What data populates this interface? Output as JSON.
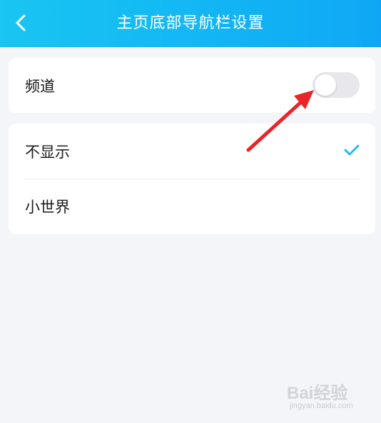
{
  "header": {
    "title": "主页底部导航栏设置",
    "back_icon": "chevron-left-icon"
  },
  "channel": {
    "label": "频道",
    "toggle_on": false
  },
  "options": [
    {
      "label": "不显示",
      "selected": true
    },
    {
      "label": "小世界",
      "selected": false
    }
  ],
  "colors": {
    "header_start": "#19c5f2",
    "header_end": "#0fa7f5",
    "check": "#1fb6f0",
    "annotation_arrow": "#e8252a"
  },
  "watermark": {
    "brand": "Bai经验",
    "url": "jingyan.baidu.com"
  }
}
